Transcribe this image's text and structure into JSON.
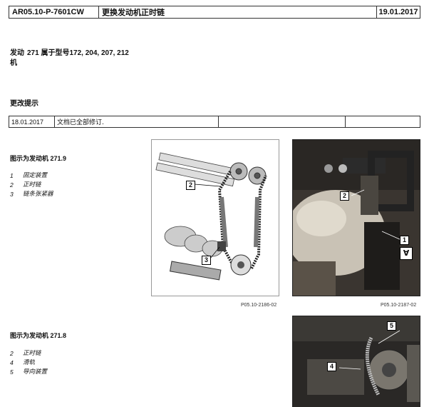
{
  "header": {
    "doc_id": "AR05.10-P-7601CW",
    "title": "更换发动机正时链",
    "date": "19.01.2017"
  },
  "engine": {
    "label_line1": "发动",
    "label_line2": "机",
    "text": "271 属于型号172, 204, 207, 212"
  },
  "changes": {
    "title": "更改提示",
    "date": "18.01.2017",
    "text": "文档已全部修订."
  },
  "section1": {
    "title": "图示为发动机 271.9",
    "items": [
      {
        "num": "1",
        "label": "固定装置"
      },
      {
        "num": "2",
        "label": "正时链"
      },
      {
        "num": "3",
        "label": "链条张紧器"
      }
    ],
    "fig1_code": "P05.10-2186-02",
    "fig2_code": "P05.10-2187-02",
    "fig1_callouts": [
      "2",
      "3"
    ],
    "fig2_callouts": [
      "2",
      "1"
    ]
  },
  "section2": {
    "title": "图示为发动机 271.8",
    "items": [
      {
        "num": "2",
        "label": "正时链"
      },
      {
        "num": "4",
        "label": "滑轨"
      },
      {
        "num": "5",
        "label": "导向装置"
      }
    ],
    "fig_callouts": [
      "5",
      "4"
    ]
  }
}
